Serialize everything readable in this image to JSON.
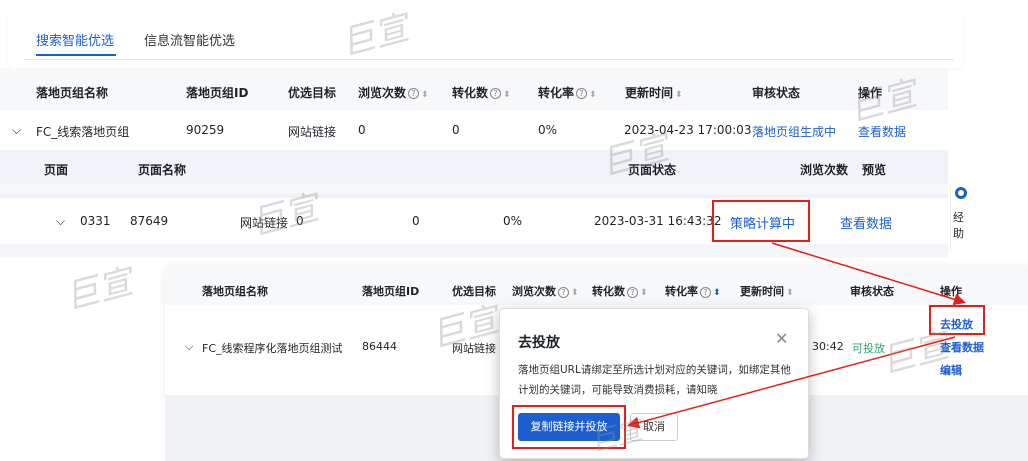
{
  "tabs": {
    "search_label": "搜索智能优选",
    "feed_label": "信息流智能优选"
  },
  "table1": {
    "headers": {
      "name": "落地页组名称",
      "id": "落地页组ID",
      "goal": "优选目标",
      "views": "浏览次数",
      "conv": "转化数",
      "rate": "转化率",
      "updated": "更新时间",
      "review": "审核状态",
      "ops": "操作"
    },
    "row": {
      "name": "FC_线索落地页组",
      "id": "90259",
      "goal": "网站链接",
      "views": "0",
      "conv": "0",
      "rate": "0%",
      "updated": "2023-04-23 17:00:03",
      "review": "落地页组生成中",
      "ops": "查看数据"
    },
    "sub_headers": {
      "page": "页面",
      "page_name": "页面名称",
      "page_status": "页面状态",
      "views": "浏览次数",
      "preview": "预览"
    },
    "sub_row": {
      "page": "0331",
      "page_id": "87649",
      "goal": "网站链接",
      "views": "0",
      "conv": "0",
      "rate": "0%",
      "updated": "2023-03-31 16:43:32",
      "status": "策略计算中",
      "ops": "查看数据"
    }
  },
  "side": {
    "line1": "经",
    "line2": "助"
  },
  "table2": {
    "headers": {
      "name": "落地页组名称",
      "id": "落地页组ID",
      "goal": "优选目标",
      "views": "浏览次数",
      "conv": "转化数",
      "rate": "转化率",
      "updated": "更新时间",
      "review": "审核状态",
      "ops": "操作"
    },
    "row": {
      "name": "FC_线索程序化落地页组测试",
      "id": "86444",
      "goal": "网站链接",
      "time_tail": "30:42",
      "review": "可投放",
      "op_deploy": "去投放",
      "op_view": "查看数据",
      "op_edit": "编辑"
    }
  },
  "modal": {
    "title": "去投放",
    "body": "落地页组URL请绑定至所选计划对应的关键词，如绑定其他计划的关键词，可能导致消费损耗，请知晓",
    "copy_label": "复制链接并投放",
    "cancel_label": "取消"
  },
  "watermark": "巨宣",
  "icons": {
    "close": "close-icon",
    "expand": "chevron-down-icon",
    "help": "question-circle-icon",
    "sort": "sort-icon"
  },
  "colors": {
    "primary": "#1d5fd1",
    "highlight": "#e0201b",
    "success": "#2ba471"
  }
}
